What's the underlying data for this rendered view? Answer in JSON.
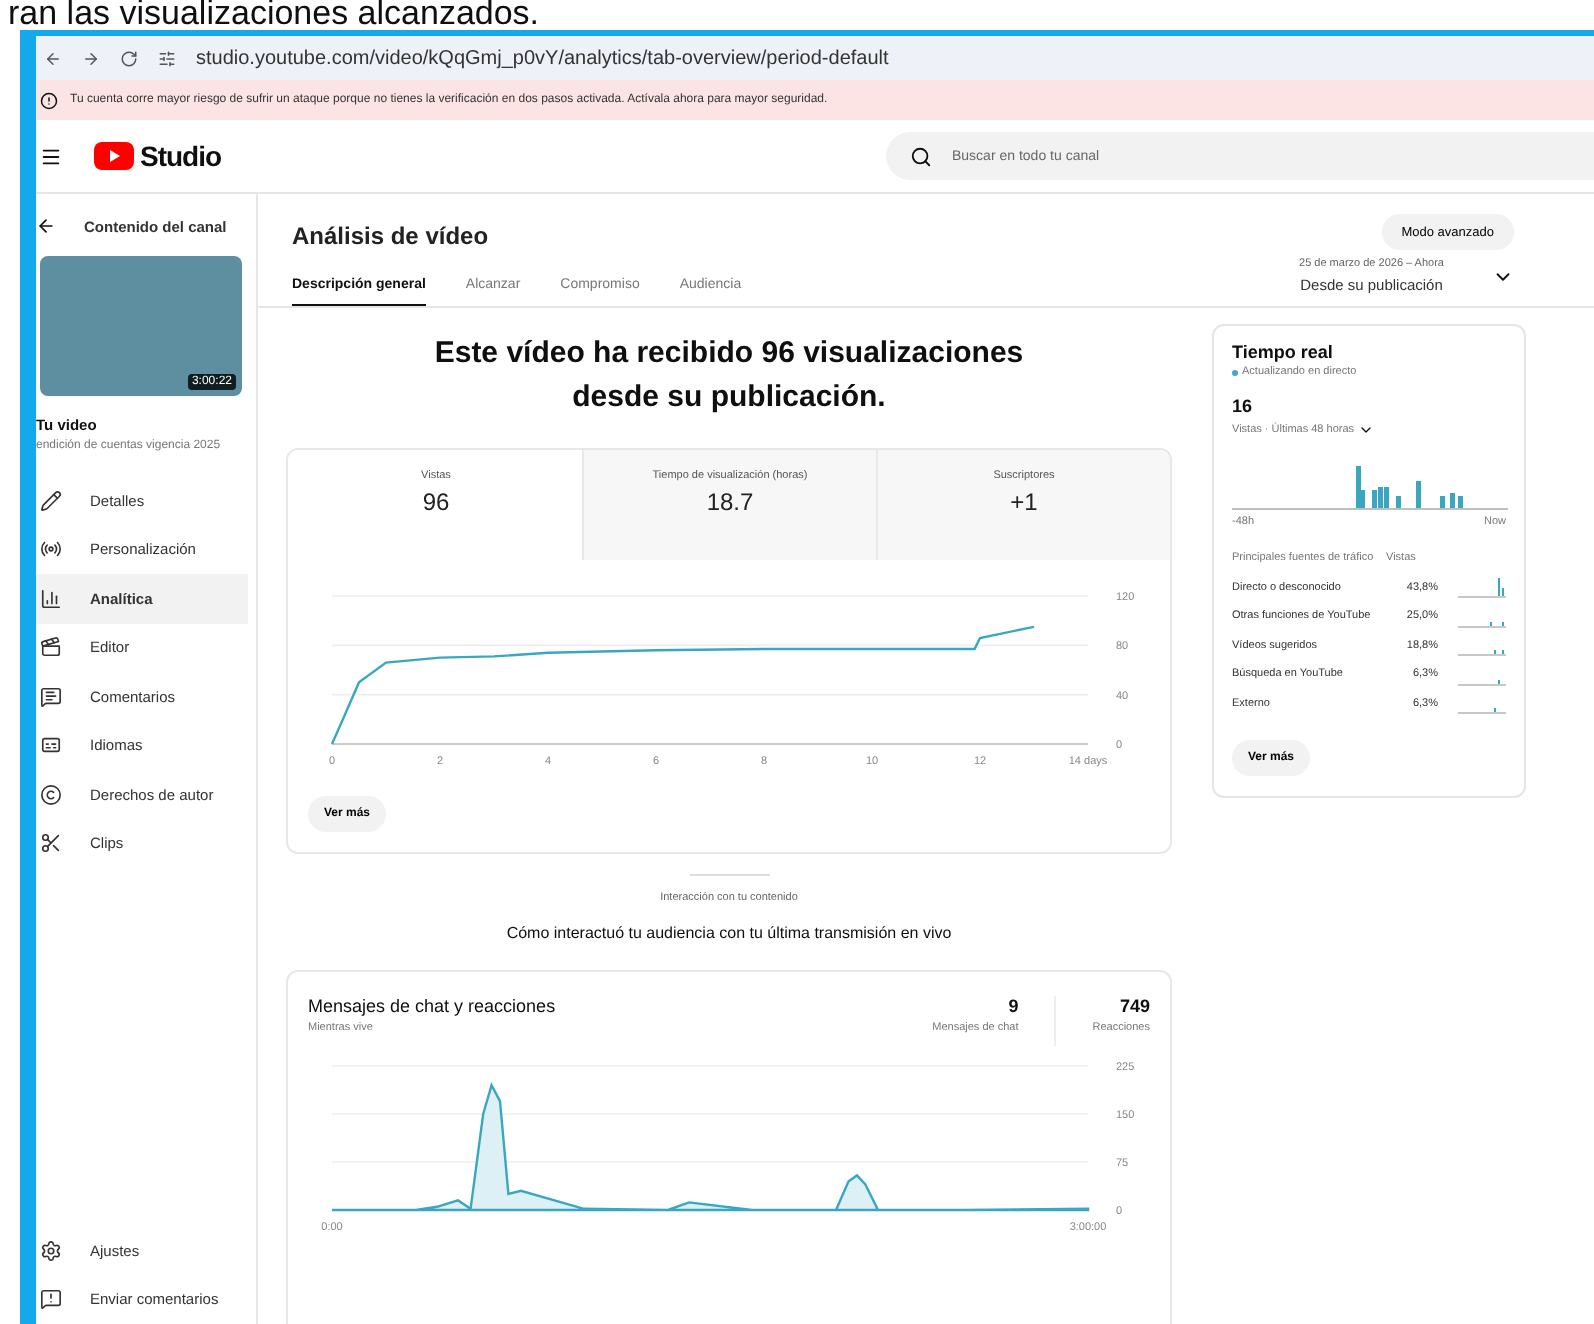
{
  "caption": "ran las visualizaciones alcanzados.",
  "browser": {
    "url": "studio.youtube.com/video/kQqGmj_p0vY/analytics/tab-overview/period-default"
  },
  "alert": {
    "text": "Tu cuenta corre mayor riesgo de sufrir un ataque porque no tienes la verificación en dos pasos activada. Actívala ahora para mayor seguridad."
  },
  "header": {
    "logo_text": "Studio",
    "search": {
      "placeholder": "Buscar en todo tu canal"
    }
  },
  "sidebar": {
    "back_label": "Contenido del canal",
    "video": {
      "duration": "3:00:22",
      "title": "Tu video",
      "subtitle": "endición de cuentas vigencia 2025"
    },
    "items": [
      {
        "label": "Detalles",
        "selected": false
      },
      {
        "label": "Personalización",
        "selected": false
      },
      {
        "label": "Analítica",
        "selected": true
      },
      {
        "label": "Editor",
        "selected": false
      },
      {
        "label": "Comentarios",
        "selected": false
      },
      {
        "label": "Idiomas",
        "selected": false
      },
      {
        "label": "Derechos de autor",
        "selected": false
      },
      {
        "label": "Clips",
        "selected": false
      }
    ],
    "footer": [
      {
        "label": "Ajustes"
      },
      {
        "label": "Enviar comentarios"
      }
    ]
  },
  "page": {
    "title": "Análisis de vídeo",
    "advanced_button": "Modo avanzado",
    "date_range": {
      "range": "25 de marzo de 2026 – Ahora",
      "label": "Desde su publicación"
    },
    "tabs": [
      {
        "label": "Descripción general",
        "selected": true
      },
      {
        "label": "Alcanzar",
        "selected": false
      },
      {
        "label": "Compromiso",
        "selected": false
      },
      {
        "label": "Audiencia",
        "selected": false
      }
    ]
  },
  "overview": {
    "headline": "Este vídeo ha recibido 96 visualizaciones desde su publicación.",
    "metrics": [
      {
        "label": "Vistas",
        "value": "96",
        "selected": true
      },
      {
        "label": "Tiempo de visualización (horas)",
        "value": "18.7",
        "selected": false
      },
      {
        "label": "Suscriptores",
        "value": "+1",
        "selected": false
      }
    ],
    "chart_data": {
      "type": "line",
      "x": [
        0,
        0.2,
        0.5,
        1,
        2,
        3,
        4,
        6,
        8,
        10,
        11.9,
        12,
        13
      ],
      "values": [
        0,
        20,
        50,
        66,
        70,
        71,
        74,
        76,
        77,
        77,
        77,
        86,
        95
      ],
      "xlim": [
        0,
        14
      ],
      "ylim": [
        0,
        120
      ],
      "xticks": [
        0,
        2,
        4,
        6,
        8,
        10,
        12,
        {
          "value": 14,
          "label": "14 days"
        }
      ],
      "yticks": [
        0,
        40,
        80,
        120
      ]
    },
    "more_button": "Ver más"
  },
  "realtime": {
    "title": "Tiempo real",
    "status": "Actualizando en directo",
    "count": "16",
    "period": "Vistas · Últimas 48 horas",
    "axis_start": "-48h",
    "axis_end": "Now",
    "columns": [
      "Principales fuentes de tráfico",
      "Vistas"
    ],
    "rows": [
      {
        "source": "Directo o desconocido",
        "share": "43,8%"
      },
      {
        "source": "Otras funciones de YouTube",
        "share": "25,0%"
      },
      {
        "source": "Vídeos sugeridos",
        "share": "18,8%"
      },
      {
        "source": "Búsqueda en YouTube",
        "share": "6,3%"
      },
      {
        "source": "Externo",
        "share": "6,3%"
      }
    ],
    "more_button": "Ver más"
  },
  "engagement": {
    "kicker": "Interacción con tu contenido",
    "heading": "Cómo interactuó tu audiencia con tu última transmisión en vivo",
    "card": {
      "title": "Mensajes de chat y reacciones",
      "subtitle": "Mientras vive",
      "stats": [
        {
          "value": "9",
          "label": "Mensajes de chat"
        },
        {
          "value": "749",
          "label": "Reacciones"
        }
      ],
      "chart_data": {
        "type": "area",
        "x": [
          0,
          20,
          25,
          30,
          33,
          36,
          38,
          40,
          42,
          45,
          60,
          80,
          85,
          100,
          120,
          123,
          125,
          127,
          130,
          150,
          180
        ],
        "values": [
          0,
          0,
          5,
          15,
          2,
          150,
          195,
          170,
          25,
          30,
          2,
          0,
          12,
          0,
          0,
          45,
          54,
          40,
          0,
          0,
          2
        ],
        "xlim": [
          0,
          180
        ],
        "ylim": [
          0,
          225
        ],
        "xticks": [
          {
            "value": 0,
            "label": "0:00"
          },
          {
            "value": 180,
            "label": "3:00:00"
          }
        ],
        "yticks": [
          0,
          75,
          150,
          225
        ]
      }
    }
  }
}
